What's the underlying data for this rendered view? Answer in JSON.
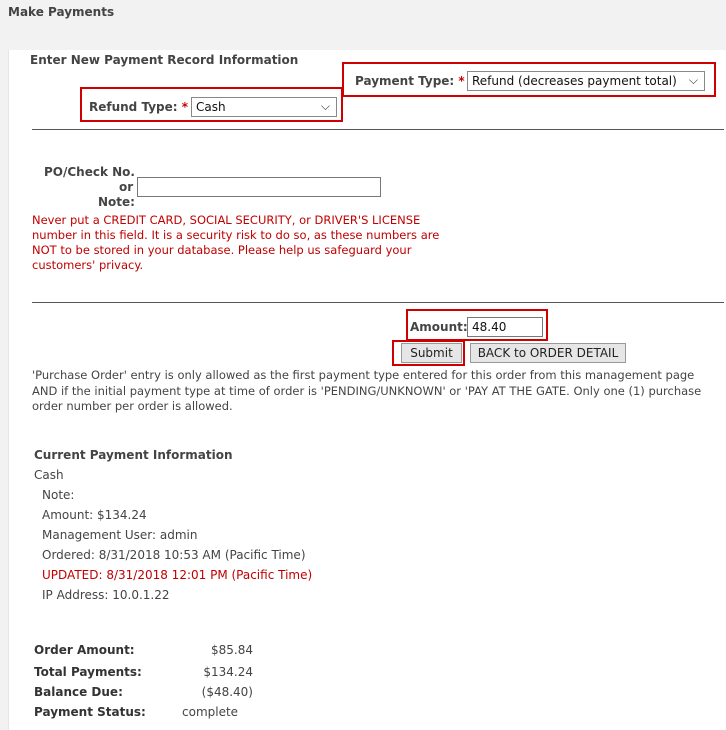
{
  "page": {
    "title": "Make Payments"
  },
  "form": {
    "section_title": "Enter New Payment Record Information",
    "payment_type": {
      "label": "Payment Type:",
      "required_mark": "*",
      "value": "Refund (decreases payment total)"
    },
    "refund_type": {
      "label": "Refund Type:",
      "required_mark": "*",
      "value": "Cash"
    },
    "po_check": {
      "label_line1": "PO/Check No.",
      "label_line2": "or",
      "label_line3": "Note:",
      "value": ""
    },
    "warning_text": "Never put a CREDIT CARD, SOCIAL SECURITY, or DRIVER'S LICENSE number in this field. It is a security risk to do so, as these numbers are NOT to be stored in your database. Please help us safeguard your customers' privacy.",
    "amount": {
      "label": "Amount:",
      "value": "48.40"
    },
    "submit_label": "Submit",
    "back_label": "BACK to ORDER DETAIL",
    "po_note": "'Purchase Order' entry is only allowed as the first payment type entered for this order from this management page AND if the initial payment type at time of order is 'PENDING/UNKNOWN' or 'PAY AT THE GATE. Only one (1) purchase order number per order is allowed."
  },
  "current_payment": {
    "title": "Current Payment Information",
    "method": "Cash",
    "note": "Note:",
    "amount": "Amount: $134.24",
    "management_user": "Management User: admin",
    "ordered": "Ordered: 8/31/2018 10:53 AM (Pacific Time)",
    "updated": "UPDATED: 8/31/2018 12:01 PM (Pacific Time)",
    "ip_address": "IP Address: 10.0.1.22"
  },
  "summary": {
    "order_amount_label": "Order Amount:",
    "order_amount": "$85.84",
    "total_payments_label": "Total Payments:",
    "total_payments": "$134.24",
    "balance_due_label": "Balance Due:",
    "balance_due": "($48.40)",
    "payment_status_label": "Payment Status:",
    "payment_status": "complete"
  },
  "colors": {
    "highlight": "#d00000",
    "warning_text": "#c00000",
    "background": "#f2f2f2"
  },
  "icons": {
    "dropdown": "chevron-down-icon"
  }
}
